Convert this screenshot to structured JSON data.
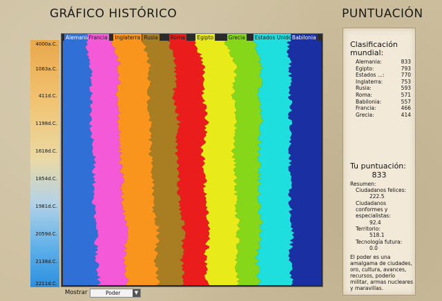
{
  "header": {
    "history_title": "GRÁFICO HISTÓRICO",
    "score_title": "PUNTUACIÓN"
  },
  "timeline": [
    "4000a.C.",
    "1063a.C.",
    "411d.C.",
    "1198d.C.",
    "1618d.C.",
    "1854d.C.",
    "1981d.C.",
    "2059d.C.",
    "2138d.C.",
    "2211d.C."
  ],
  "chart_data": {
    "type": "area",
    "x": [
      "4000a.C.",
      "1063a.C.",
      "411d.C.",
      "1198d.C.",
      "1618d.C.",
      "1854d.C.",
      "1981d.C.",
      "2059d.C.",
      "2138d.C.",
      "2211d.C."
    ],
    "series": [
      {
        "name": "Alemania",
        "color": "#2f6fd6",
        "values": [
          0.09,
          0.11,
          0.11,
          0.11,
          0.12,
          0.12,
          0.12,
          0.13,
          0.13,
          0.14
        ]
      },
      {
        "name": "Francia",
        "color": "#f45ad8",
        "values": [
          0.1,
          0.11,
          0.1,
          0.11,
          0.1,
          0.11,
          0.11,
          0.12,
          0.11,
          0.11
        ]
      },
      {
        "name": "Inglaterra",
        "color": "#f9941c",
        "values": [
          0.12,
          0.12,
          0.12,
          0.12,
          0.12,
          0.12,
          0.12,
          0.12,
          0.12,
          0.12
        ]
      },
      {
        "name": "Rusia",
        "color": "#a97e22",
        "values": [
          0.1,
          0.1,
          0.1,
          0.11,
          0.1,
          0.1,
          0.1,
          0.1,
          0.1,
          0.1
        ]
      },
      {
        "name": "Roma",
        "color": "#ea1c1c",
        "values": [
          0.1,
          0.11,
          0.11,
          0.11,
          0.1,
          0.1,
          0.1,
          0.1,
          0.09,
          0.09
        ]
      },
      {
        "name": "Egipto",
        "color": "#e9ea1a",
        "values": [
          0.12,
          0.12,
          0.12,
          0.11,
          0.12,
          0.12,
          0.12,
          0.11,
          0.12,
          0.12
        ]
      },
      {
        "name": "Grecia",
        "color": "#86d61a",
        "values": [
          0.11,
          0.1,
          0.1,
          0.1,
          0.1,
          0.09,
          0.09,
          0.09,
          0.08,
          0.08
        ]
      },
      {
        "name": "Estados Unidos",
        "color": "#1fdede",
        "values": [
          0.13,
          0.11,
          0.12,
          0.11,
          0.12,
          0.12,
          0.12,
          0.12,
          0.13,
          0.13
        ]
      },
      {
        "name": "Babilonia",
        "color": "#1a2fa2",
        "values": [
          0.13,
          0.12,
          0.12,
          0.12,
          0.12,
          0.12,
          0.12,
          0.11,
          0.12,
          0.11
        ]
      }
    ]
  },
  "score": {
    "ranking_title": "Clasificación mundial:",
    "ranking": [
      {
        "name": "Alemania:",
        "value": "833"
      },
      {
        "name": "Egipto:",
        "value": "793"
      },
      {
        "name": "Estados ...:",
        "value": "770"
      },
      {
        "name": "Inglaterra:",
        "value": "753"
      },
      {
        "name": "Rusia:",
        "value": "593"
      },
      {
        "name": "Roma:",
        "value": "571"
      },
      {
        "name": "Babilonia:",
        "value": "557"
      },
      {
        "name": "Francia:",
        "value": "466"
      },
      {
        "name": "Grecia:",
        "value": "414"
      }
    ],
    "your_score_label": "Tu puntuación:",
    "your_score": "833",
    "summary_label": "Resumen:",
    "happy_label": "Ciudadanos felices:",
    "happy_value": "222.5",
    "content_label": "Ciudadanos conformes y especialistas:",
    "content_value": "92.4",
    "territory_label": "Territorio:",
    "territory_value": "518.1",
    "future_tech_label": "Tecnología futura:",
    "future_tech_value": "0.0",
    "description": "El poder es una amalgama de ciudades, oro, cultura, avances, recursos, poderío militar, armas nucleares y maravillas."
  },
  "controls": {
    "show_label": "Mostrar",
    "show_value": "Poder"
  }
}
